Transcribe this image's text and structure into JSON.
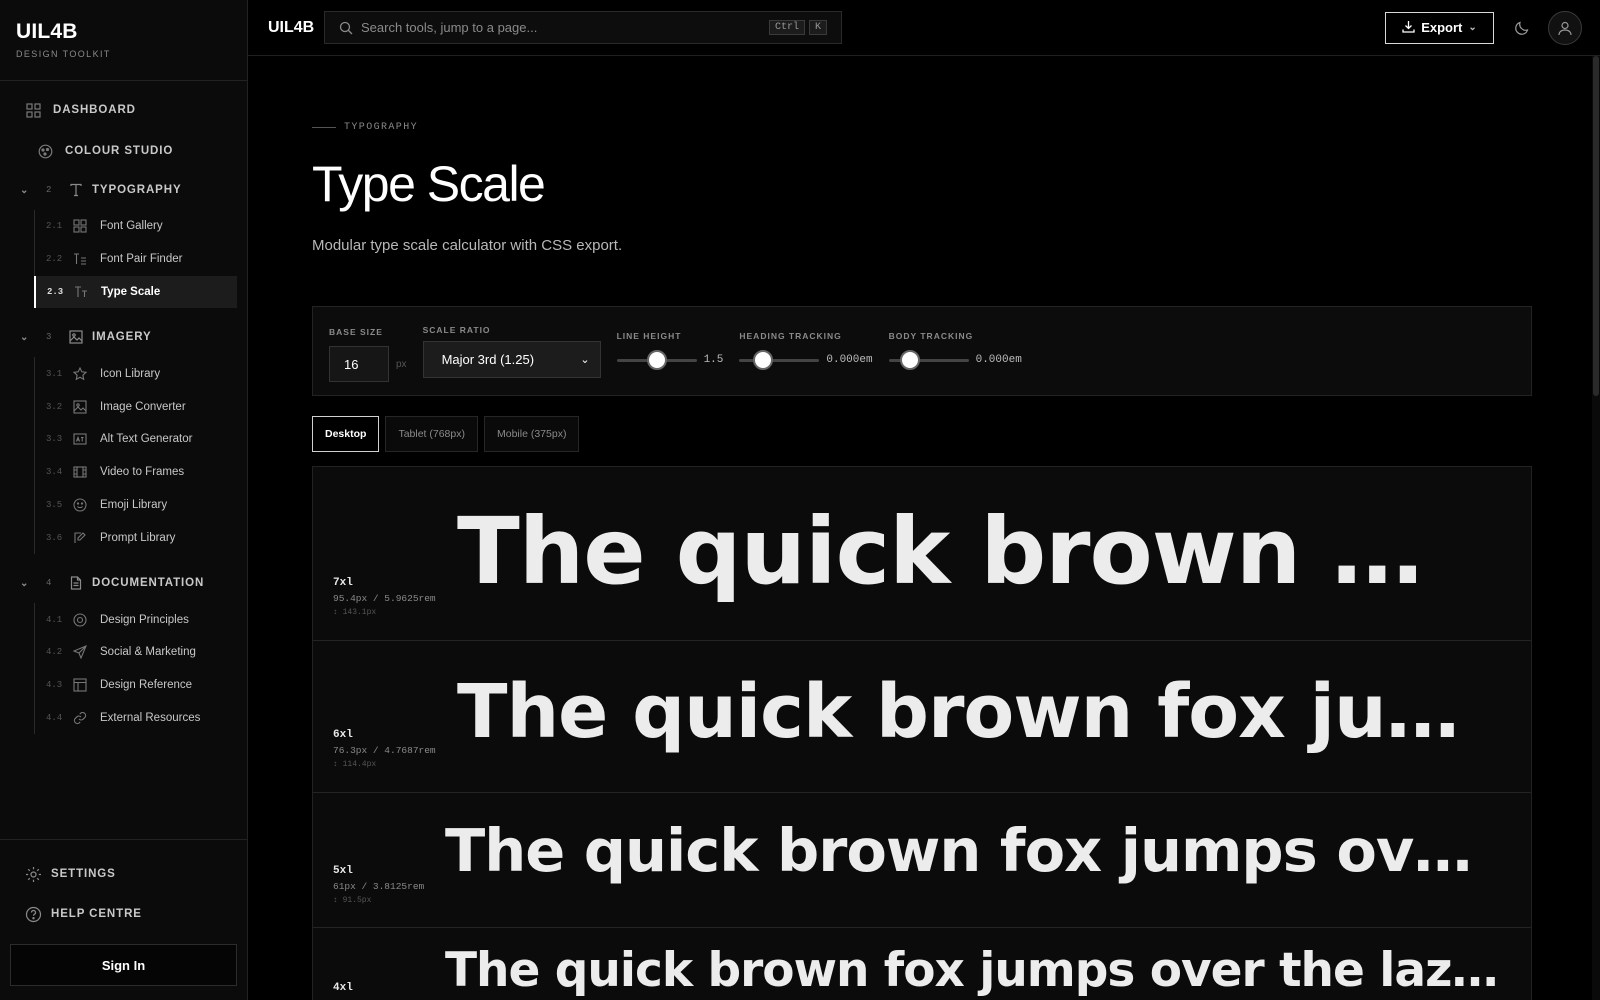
{
  "brand": {
    "name": "UIL4B",
    "subtitle": "DESIGN TOOLKIT"
  },
  "sidebar": {
    "dashboard": "DASHBOARD",
    "colour_studio": "COLOUR STUDIO",
    "groups": [
      {
        "num": "2",
        "label": "TYPOGRAPHY",
        "icon": "type-icon",
        "items": [
          {
            "num": "2.1",
            "label": "Font Gallery",
            "icon": "grid-icon"
          },
          {
            "num": "2.2",
            "label": "Font Pair Finder",
            "icon": "text-pair-icon"
          },
          {
            "num": "2.3",
            "label": "Type Scale",
            "icon": "type-scale-icon",
            "active": true
          }
        ]
      },
      {
        "num": "3",
        "label": "IMAGERY",
        "icon": "image-icon",
        "items": [
          {
            "num": "3.1",
            "label": "Icon Library",
            "icon": "star-icon"
          },
          {
            "num": "3.2",
            "label": "Image Converter",
            "icon": "image-icon"
          },
          {
            "num": "3.3",
            "label": "Alt Text Generator",
            "icon": "alt-text-icon"
          },
          {
            "num": "3.4",
            "label": "Video to Frames",
            "icon": "film-icon"
          },
          {
            "num": "3.5",
            "label": "Emoji Library",
            "icon": "smile-icon"
          },
          {
            "num": "3.6",
            "label": "Prompt Library",
            "icon": "edit-icon"
          }
        ]
      },
      {
        "num": "4",
        "label": "DOCUMENTATION",
        "icon": "document-icon",
        "items": [
          {
            "num": "4.1",
            "label": "Design Principles",
            "icon": "target-icon"
          },
          {
            "num": "4.2",
            "label": "Social & Marketing",
            "icon": "send-icon"
          },
          {
            "num": "4.3",
            "label": "Design Reference",
            "icon": "layout-icon"
          },
          {
            "num": "4.4",
            "label": "External Resources",
            "icon": "link-icon"
          }
        ]
      }
    ],
    "settings": "SETTINGS",
    "help": "HELP CENTRE",
    "sign_in": "Sign In"
  },
  "topbar": {
    "brand": "UIL4B",
    "search_placeholder": "Search tools, jump to a page...",
    "kbd_ctrl": "Ctrl",
    "kbd_k": "K",
    "export_label": "Export"
  },
  "page": {
    "eyebrow": "TYPOGRAPHY",
    "title": "Type Scale",
    "description": "Modular type scale calculator with CSS export."
  },
  "controls": {
    "base_size_label": "BASE SIZE",
    "base_size_value": "16",
    "base_size_unit": "px",
    "scale_ratio_label": "SCALE RATIO",
    "scale_ratio_value": "Major 3rd (1.25)",
    "line_height_label": "LINE HEIGHT",
    "line_height_value": "1.5",
    "line_height_fraction": 0.5,
    "heading_tracking_label": "HEADING TRACKING",
    "heading_tracking_value": "0.000em",
    "heading_tracking_fraction": 0.3,
    "body_tracking_label": "BODY TRACKING",
    "body_tracking_value": "0.000em",
    "body_tracking_fraction": 0.27
  },
  "tabs": [
    {
      "label": "Desktop",
      "active": true
    },
    {
      "label": "Tablet (768px)",
      "active": false
    },
    {
      "label": "Mobile (375px)",
      "active": false
    }
  ],
  "scale_rows": [
    {
      "label": "7xl",
      "size": "95.4px / 5.9625rem",
      "line_height": "↕ 143.1px",
      "sample": "The quick brown fox jumps over the lazy dog"
    },
    {
      "label": "6xl",
      "size": "76.3px / 4.7687rem",
      "line_height": "↕ 114.4px",
      "sample": "The quick brown fox jumps over the lazy dog"
    },
    {
      "label": "5xl",
      "size": "61px / 3.8125rem",
      "line_height": "↕ 91.5px",
      "sample": "The quick brown fox jumps over the lazy dog"
    },
    {
      "label": "4xl",
      "size": "",
      "line_height": "",
      "sample": "The quick brown fox jumps over the lazy dog"
    }
  ]
}
